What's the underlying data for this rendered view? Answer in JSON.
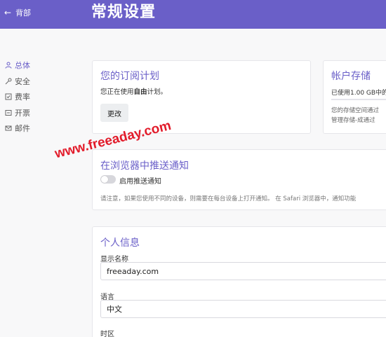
{
  "header": {
    "back_label": "背部",
    "title": "常规设置"
  },
  "sidebar": {
    "items": [
      {
        "label": "总体",
        "icon": "user-icon",
        "active": true
      },
      {
        "label": "安全",
        "icon": "key-icon",
        "active": false
      },
      {
        "label": "费率",
        "icon": "check-square-icon",
        "active": false
      },
      {
        "label": "开票",
        "icon": "invoice-icon",
        "active": false
      },
      {
        "label": "邮件",
        "icon": "mail-icon",
        "active": false
      }
    ]
  },
  "subscription": {
    "title": "您的订阅计划",
    "text_prefix": "您正在使用",
    "plan": "自由",
    "text_suffix": "计划。",
    "change_label": "更改"
  },
  "storage": {
    "title": "帐户存储",
    "used_text": "已使用1.00 GB中的",
    "note_line1": "您的存储空间通过",
    "note_line2": "管理存储-成通过",
    "accent": "#6a5fc8"
  },
  "push": {
    "title": "在浏览器中推送通知",
    "toggle_label": "启用推送通知",
    "enabled": false,
    "note": "请注意，如果您使用不同的设备，则需要在每台设备上打开通知。 在 Safari 浏览器中，通知功能"
  },
  "profile": {
    "title": "个人信息",
    "display_name_label": "显示名称",
    "display_name_value": "freeaday.com",
    "language_label": "语言",
    "language_value": "中文",
    "timezone_label": "时区"
  },
  "watermark": "www.freeaday.com"
}
